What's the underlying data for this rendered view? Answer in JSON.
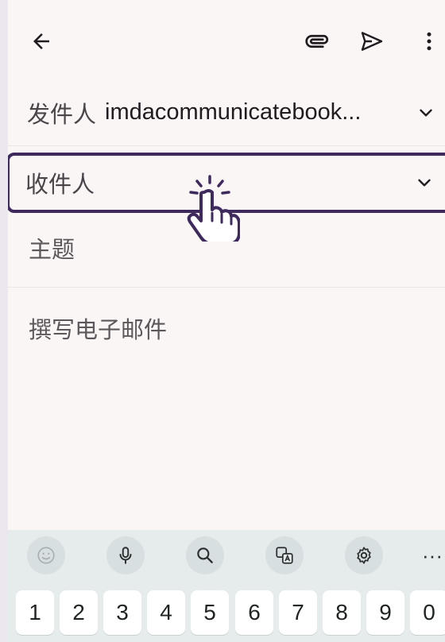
{
  "toolbar": {
    "back_icon": "arrow-left-icon",
    "attach_icon": "paperclip-icon",
    "send_icon": "send-icon",
    "more_icon": "more-vert-icon"
  },
  "from": {
    "label": "发件人",
    "value": "imdacommunicatebook..."
  },
  "to": {
    "label": "收件人",
    "value": ""
  },
  "subject": {
    "placeholder": "主题"
  },
  "body": {
    "placeholder": "撰写电子邮件"
  },
  "keyboard": {
    "tools": [
      "emoji-icon",
      "mic-icon",
      "search-icon",
      "translate-icon",
      "settings-icon"
    ],
    "more_label": "···",
    "number_row": [
      "1",
      "2",
      "3",
      "4",
      "5",
      "6",
      "7",
      "8",
      "9",
      "0"
    ]
  },
  "colors": {
    "focus_border": "#3f2a5e",
    "background": "#faf6f6",
    "keyboard_bg": "#e6ecec"
  }
}
